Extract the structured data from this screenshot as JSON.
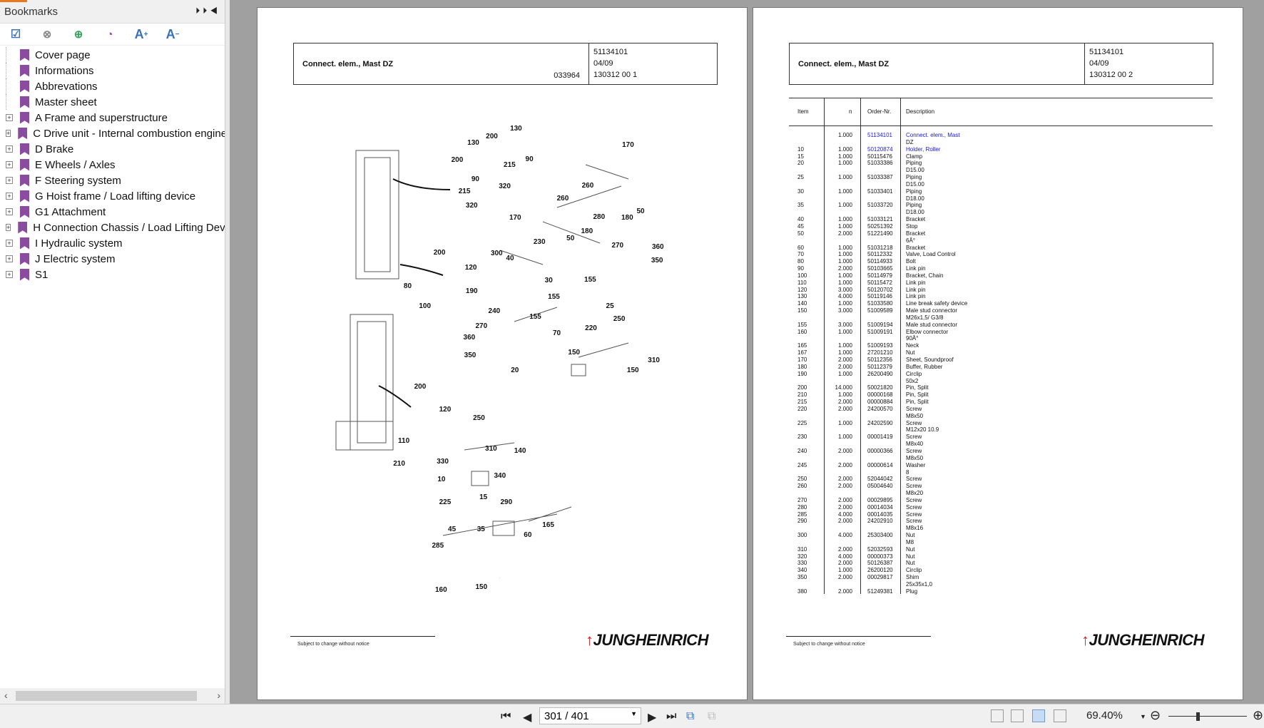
{
  "sidebar": {
    "title": "Bookmarks",
    "items": [
      {
        "label": "Cover page",
        "expandable": false
      },
      {
        "label": "Informations",
        "expandable": false
      },
      {
        "label": "Abbrevations",
        "expandable": false
      },
      {
        "label": "Master sheet",
        "expandable": false
      },
      {
        "label": "A Frame and superstructure",
        "expandable": true
      },
      {
        "label": "C Drive unit - Internal combustion engine",
        "expandable": true
      },
      {
        "label": "D Brake",
        "expandable": true
      },
      {
        "label": "E Wheels / Axles",
        "expandable": true
      },
      {
        "label": "F Steering system",
        "expandable": true
      },
      {
        "label": "G Hoist frame / Load lifting device",
        "expandable": true
      },
      {
        "label": "G1 Attachment",
        "expandable": true
      },
      {
        "label": "H Connection Chassis / Load Lifting Device",
        "expandable": true
      },
      {
        "label": "I Hydraulic system",
        "expandable": true
      },
      {
        "label": "J Electric system",
        "expandable": true
      },
      {
        "label": "S1",
        "expandable": true
      }
    ]
  },
  "page1": {
    "title": "Connect. elem., Mast DZ",
    "code": "033964",
    "order": "51134101",
    "date": "04/09",
    "ref": "130312 00 1",
    "footer": "Subject to change without notice",
    "logo": "JUNGHEINRICH",
    "callouts": [
      "130",
      "200",
      "130",
      "170",
      "200",
      "90",
      "215",
      "260",
      "90",
      "215",
      "320",
      "260",
      "320",
      "170",
      "280",
      "180",
      "50",
      "180",
      "50",
      "230",
      "270",
      "360",
      "350",
      "200",
      "300",
      "40",
      "120",
      "155",
      "30",
      "80",
      "190",
      "155",
      "100",
      "240",
      "25",
      "155",
      "250",
      "270",
      "70",
      "220",
      "360",
      "350",
      "150",
      "310",
      "150",
      "20",
      "200",
      "120",
      "250",
      "110",
      "310",
      "140",
      "210",
      "330",
      "340",
      "10",
      "15",
      "290",
      "225",
      "45",
      "35",
      "165",
      "60",
      "285",
      "160",
      "150"
    ]
  },
  "page2": {
    "title": "Connect. elem., Mast DZ",
    "order": "51134101",
    "date": "04/09",
    "ref": "130312 00 2",
    "footer": "Subject to change without notice",
    "logo": "JUNGHEINRICH",
    "headers": {
      "item": "Item",
      "n": "n",
      "order": "Order-Nr.",
      "desc": "Description"
    },
    "rows": [
      [
        "",
        "1.000",
        "51134101",
        "Connect. elem., Mast",
        "DZ",
        true
      ],
      [
        "10",
        "1.000",
        "50120874",
        "Holder, Roller",
        "",
        true
      ],
      [
        "15",
        "1.000",
        "50115476",
        "Clamp",
        ""
      ],
      [
        "20",
        "1.000",
        "51033386",
        "Piping",
        "D15.00"
      ],
      [
        "25",
        "1.000",
        "51033387",
        "Piping",
        "D15.00"
      ],
      [
        "30",
        "1.000",
        "51033401",
        "Piping",
        "D18.00"
      ],
      [
        "35",
        "1.000",
        "51033720",
        "Piping",
        "D18.00"
      ],
      [
        "40",
        "1.000",
        "51033121",
        "Bracket",
        ""
      ],
      [
        "45",
        "1.000",
        "50251392",
        "Stop",
        ""
      ],
      [
        "50",
        "2.000",
        "51221490",
        "Bracket",
        "6Â°"
      ],
      [
        "60",
        "1.000",
        "51031218",
        "Bracket",
        ""
      ],
      [
        "70",
        "1.000",
        "50112332",
        "Valve, Load Control",
        ""
      ],
      [
        "80",
        "1.000",
        "50114933",
        "Bolt",
        ""
      ],
      [
        "90",
        "2.000",
        "50103665",
        "Link pin",
        ""
      ],
      [
        "100",
        "1.000",
        "50114979",
        "Bracket, Chain",
        ""
      ],
      [
        "110",
        "1.000",
        "50115472",
        "Link pin",
        ""
      ],
      [
        "120",
        "3.000",
        "50120702",
        "Link pin",
        ""
      ],
      [
        "130",
        "4.000",
        "50119146",
        "Link pin",
        ""
      ],
      [
        "140",
        "1.000",
        "51033580",
        "Line break safety device",
        ""
      ],
      [
        "150",
        "3.000",
        "51009589",
        "Male stud connector",
        "M26x1,5/ G3/8"
      ],
      [
        "155",
        "3.000",
        "51009194",
        "Male stud connector",
        ""
      ],
      [
        "160",
        "1.000",
        "51009191",
        "Elbow connector",
        "90Â°"
      ],
      [
        "165",
        "1.000",
        "51009193",
        "Neck",
        ""
      ],
      [
        "167",
        "1.000",
        "27201210",
        "Nut",
        ""
      ],
      [
        "170",
        "2.000",
        "50112356",
        "Sheet, Soundproof",
        ""
      ],
      [
        "180",
        "2.000",
        "50112379",
        "Buffer, Rubber",
        ""
      ],
      [
        "190",
        "1.000",
        "26200490",
        "Circlip",
        "50x2"
      ],
      [
        "200",
        "14.000",
        "50021820",
        "Pin, Split",
        ""
      ],
      [
        "210",
        "1.000",
        "00000168",
        "Pin, Split",
        ""
      ],
      [
        "215",
        "2.000",
        "00000884",
        "Pin, Split",
        ""
      ],
      [
        "220",
        "2.000",
        "24200570",
        "Screw",
        "M8x50"
      ],
      [
        "225",
        "1.000",
        "24202590",
        "Screw",
        "M12x20 10.9"
      ],
      [
        "230",
        "1.000",
        "00001419",
        "Screw",
        "M8x40"
      ],
      [
        "240",
        "2.000",
        "00000366",
        "Screw",
        "M8x50"
      ],
      [
        "245",
        "2.000",
        "00000614",
        "Washer",
        "8"
      ],
      [
        "250",
        "2.000",
        "52044042",
        "Screw",
        ""
      ],
      [
        "260",
        "2.000",
        "05004640",
        "Screw",
        "M8x20"
      ],
      [
        "270",
        "2.000",
        "00029895",
        "Screw",
        ""
      ],
      [
        "280",
        "2.000",
        "00014034",
        "Screw",
        ""
      ],
      [
        "285",
        "4.000",
        "00014035",
        "Screw",
        ""
      ],
      [
        "290",
        "2.000",
        "24202910",
        "Screw",
        "M8x16"
      ],
      [
        "300",
        "4.000",
        "25303400",
        "Nut",
        "M8"
      ],
      [
        "310",
        "2.000",
        "52032593",
        "Nut",
        ""
      ],
      [
        "320",
        "4.000",
        "00000373",
        "Nut",
        ""
      ],
      [
        "330",
        "2.000",
        "50126387",
        "Nut",
        ""
      ],
      [
        "340",
        "1.000",
        "26200120",
        "Circlip",
        ""
      ],
      [
        "350",
        "2.000",
        "00029817",
        "Shim",
        "25x35x1,0"
      ],
      [
        "380",
        "2.000",
        "51249381",
        "Plug",
        ""
      ]
    ]
  },
  "toolbar": {
    "page_indicator": "301 / 401",
    "zoom": "69.40%",
    "zoom_fraction": 0.35
  },
  "colors": {
    "bookmark": "#8a4c9e",
    "link": "#1a1ae0",
    "accent": "#e8791e"
  }
}
